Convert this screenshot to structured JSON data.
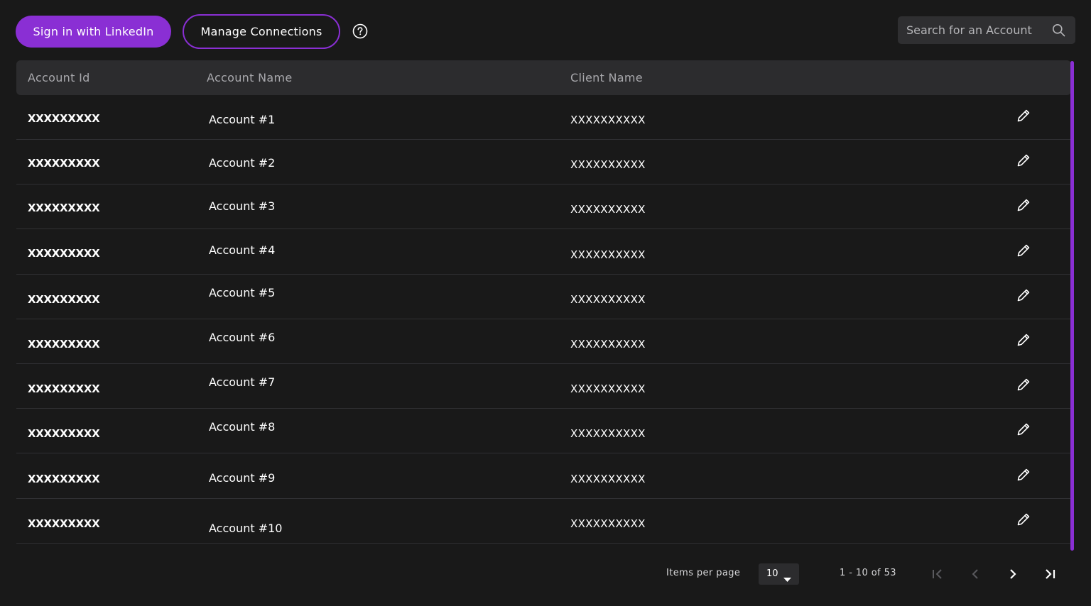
{
  "toolbar": {
    "linkedin_label": "Sign in with LinkedIn",
    "manage_label": "Manage Connections",
    "help_icon": "question-circle-icon"
  },
  "search": {
    "placeholder": "Search for an Account",
    "value": "",
    "icon": "search-icon"
  },
  "table": {
    "headers": {
      "id": "Account Id",
      "name": "Account Name",
      "client": "Client Name"
    },
    "rows": [
      {
        "id": "XXXXXXXXX",
        "name": "Account #1",
        "client": "XXXXXXXXXX"
      },
      {
        "id": "XXXXXXXXX",
        "name": "Account #2",
        "client": "XXXXXXXXXX"
      },
      {
        "id": "XXXXXXXXX",
        "name": "Account #3",
        "client": "XXXXXXXXXX"
      },
      {
        "id": "XXXXXXXXX",
        "name": "Account #4",
        "client": "XXXXXXXXXX"
      },
      {
        "id": "XXXXXXXXX",
        "name": "Account #5",
        "client": "XXXXXXXXXX"
      },
      {
        "id": "XXXXXXXXX",
        "name": "Account #6",
        "client": "XXXXXXXXXX"
      },
      {
        "id": "XXXXXXXXX",
        "name": "Account #7",
        "client": "XXXXXXXXXX"
      },
      {
        "id": "XXXXXXXXX",
        "name": "Account #8",
        "client": "XXXXXXXXXX"
      },
      {
        "id": "XXXXXXXXX",
        "name": "Account #9",
        "client": "XXXXXXXXXX"
      },
      {
        "id": "XXXXXXXXX",
        "name": "Account #10",
        "client": "XXXXXXXXXX"
      }
    ],
    "row_action_icon": "pencil-edit-icon"
  },
  "paginator": {
    "items_per_page_label": "Items per page",
    "page_size": "10",
    "range_label": "1 - 10 of 53",
    "first_icon": "first-page-icon",
    "prev_icon": "chevron-left-icon",
    "next_icon": "chevron-right-icon",
    "last_icon": "last-page-icon"
  },
  "colors": {
    "accent": "#8a2fd4",
    "background": "#191919",
    "header_bg": "#2c2c2e",
    "input_bg": "#2f2f31"
  }
}
